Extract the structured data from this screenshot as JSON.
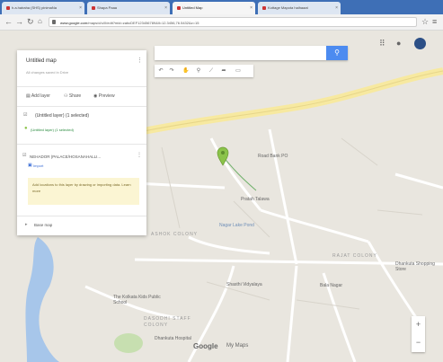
{
  "browser": {
    "tabs": [
      {
        "label": "h.a.hairaha (SHS) pinimaNa"
      },
      {
        "label": "Shapa Paaa"
      },
      {
        "label": "Untitled Map"
      },
      {
        "label": "Kottage Mapota haihaaat"
      }
    ],
    "url_host": "www.google.com",
    "url_rest": "/maps/d/u/0/edit?mid=zabcDEF123456789&ll=12.3456,76.5432&z=15"
  },
  "panel": {
    "title": "Untitled map",
    "subtitle": "All changes saved in Drive",
    "add_layer": "Add layer",
    "share": "Share",
    "preview": "Preview",
    "layer1": "(Untitled layer) (1 selected)",
    "layer1_sub": "(Untitled layer) (1 selected)",
    "layer2": "NEHADOR (PALACE/HOSANAHALLI...",
    "layer2_link": "Import",
    "hint": "Add locations to this layer by drawing or importing data. Learn more",
    "base_map": "Base map"
  },
  "map_labels": {
    "road_top": "Road Bank PO",
    "pond": "Pratah Talawa",
    "temple": "Nagar Lake Pond",
    "colony1": "ASHOK COLONY",
    "colony2": "RAJAT COLONY",
    "school": "Shasthi Vidyalaya",
    "bus": "Bala Nagar",
    "school2": "The Kolkata Kids Public School",
    "colony3": "DASODHI STAFF COLONY",
    "hospital": "Dhankuta Hospital",
    "shop": "Dhankuta Shopping Store",
    "brand": "Google",
    "brand_suffix": "My Maps"
  },
  "icons": [
    "search-icon",
    "apps-grid-icon",
    "notifications-icon",
    "account-avatar",
    "undo-icon",
    "redo-icon",
    "pan-hand-icon",
    "marker-icon",
    "polyline-icon",
    "directions-icon",
    "ruler-icon",
    "zoom-in-icon",
    "zoom-out-icon",
    "map-pin-icon"
  ],
  "colors": {
    "pin": "#8bc34a",
    "search_button": "#4c8bf0",
    "river": "#a7c6ea",
    "road": "#f7e9a0"
  }
}
